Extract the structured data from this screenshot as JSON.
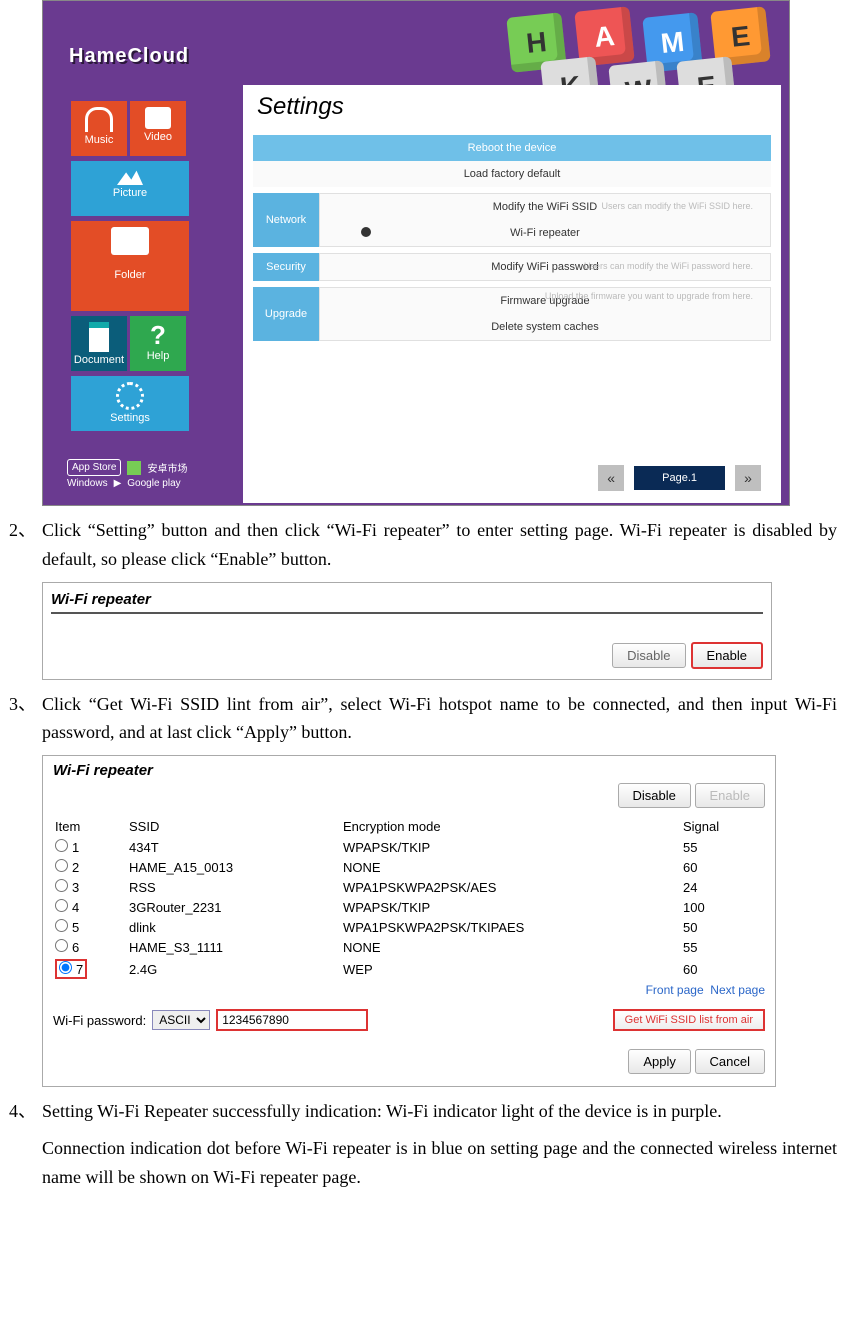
{
  "shot1": {
    "logo": "HameCloud",
    "cubes": [
      "H",
      "A",
      "M",
      "E",
      "K",
      "W",
      "E"
    ],
    "tiles": {
      "music": "Music",
      "video": "Video",
      "picture": "Picture",
      "folder": "Folder",
      "document": "Document",
      "help": "Help",
      "settings": "Settings"
    },
    "stores": {
      "appstore": "App Store",
      "anzhuo": "安卓市场",
      "windows": "Windows",
      "google": "Google play"
    },
    "panel": {
      "title": "Settings",
      "reboot": "Reboot the device",
      "factory": "Load factory default",
      "network_label": "Network",
      "modify_ssid": "Modify the WiFi SSID",
      "wifi_repeater": "Wi-Fi repeater",
      "ssid_desc": "Users can modify the WiFi SSID here.",
      "security_label": "Security",
      "modify_pw": "Modify WiFi password",
      "pw_desc": "Users can modify the WiFi password here.",
      "upgrade_label": "Upgrade",
      "firmware": "Firmware upgrade",
      "fw_desc": "Upload the firmware you want to upgrade from here.",
      "delete_cache": "Delete system caches"
    },
    "pager": {
      "prev": "«",
      "label": "Page.1",
      "next": "»"
    }
  },
  "step2": {
    "num": "2、",
    "text": "Click “Setting” button and then click “Wi-Fi repeater” to enter setting page. Wi-Fi repeater is disabled by default, so please click “Enable” button."
  },
  "shot2": {
    "title": "Wi-Fi repeater",
    "disable": "Disable",
    "enable": "Enable"
  },
  "step3": {
    "num": "3、",
    "text": "Click “Get Wi-Fi SSID lint from air”, select Wi-Fi hotspot name to be connected, and then input Wi-Fi password, and at last click “Apply” button."
  },
  "shot3": {
    "title": "Wi-Fi repeater",
    "disable": "Disable",
    "enable": "Enable",
    "headers": {
      "item": "Item",
      "ssid": "SSID",
      "enc": "Encryption mode",
      "signal": "Signal"
    },
    "rows": [
      {
        "n": "1",
        "ssid": "434T",
        "enc": "WPAPSK/TKIP",
        "sig": "55",
        "sel": false
      },
      {
        "n": "2",
        "ssid": "HAME_A15_0013",
        "enc": "NONE",
        "sig": "60",
        "sel": false
      },
      {
        "n": "3",
        "ssid": "RSS",
        "enc": "WPA1PSKWPA2PSK/AES",
        "sig": "24",
        "sel": false
      },
      {
        "n": "4",
        "ssid": "3GRouter_2231",
        "enc": "WPAPSK/TKIP",
        "sig": "100",
        "sel": false
      },
      {
        "n": "5",
        "ssid": "dlink",
        "enc": "WPA1PSKWPA2PSK/TKIPAES",
        "sig": "50",
        "sel": false
      },
      {
        "n": "6",
        "ssid": "HAME_S3_1111",
        "enc": "NONE",
        "sig": "55",
        "sel": false
      },
      {
        "n": "7",
        "ssid": "2.4G",
        "enc": "WEP",
        "sig": "60",
        "sel": true
      }
    ],
    "front": "Front page",
    "next": "Next page",
    "pw_label": "Wi-Fi password:",
    "ascii": "ASCII",
    "pw_value": "1234567890",
    "getssid": "Get WiFi SSID list from air",
    "apply": "Apply",
    "cancel": "Cancel"
  },
  "step4": {
    "num": "4、",
    "text": "Setting Wi-Fi Repeater successfully indication: Wi-Fi indicator light of the device is in purple."
  },
  "note": "Connection indication dot before Wi-Fi repeater is in blue on setting page and the connected wireless internet name will be shown on Wi-Fi repeater page."
}
